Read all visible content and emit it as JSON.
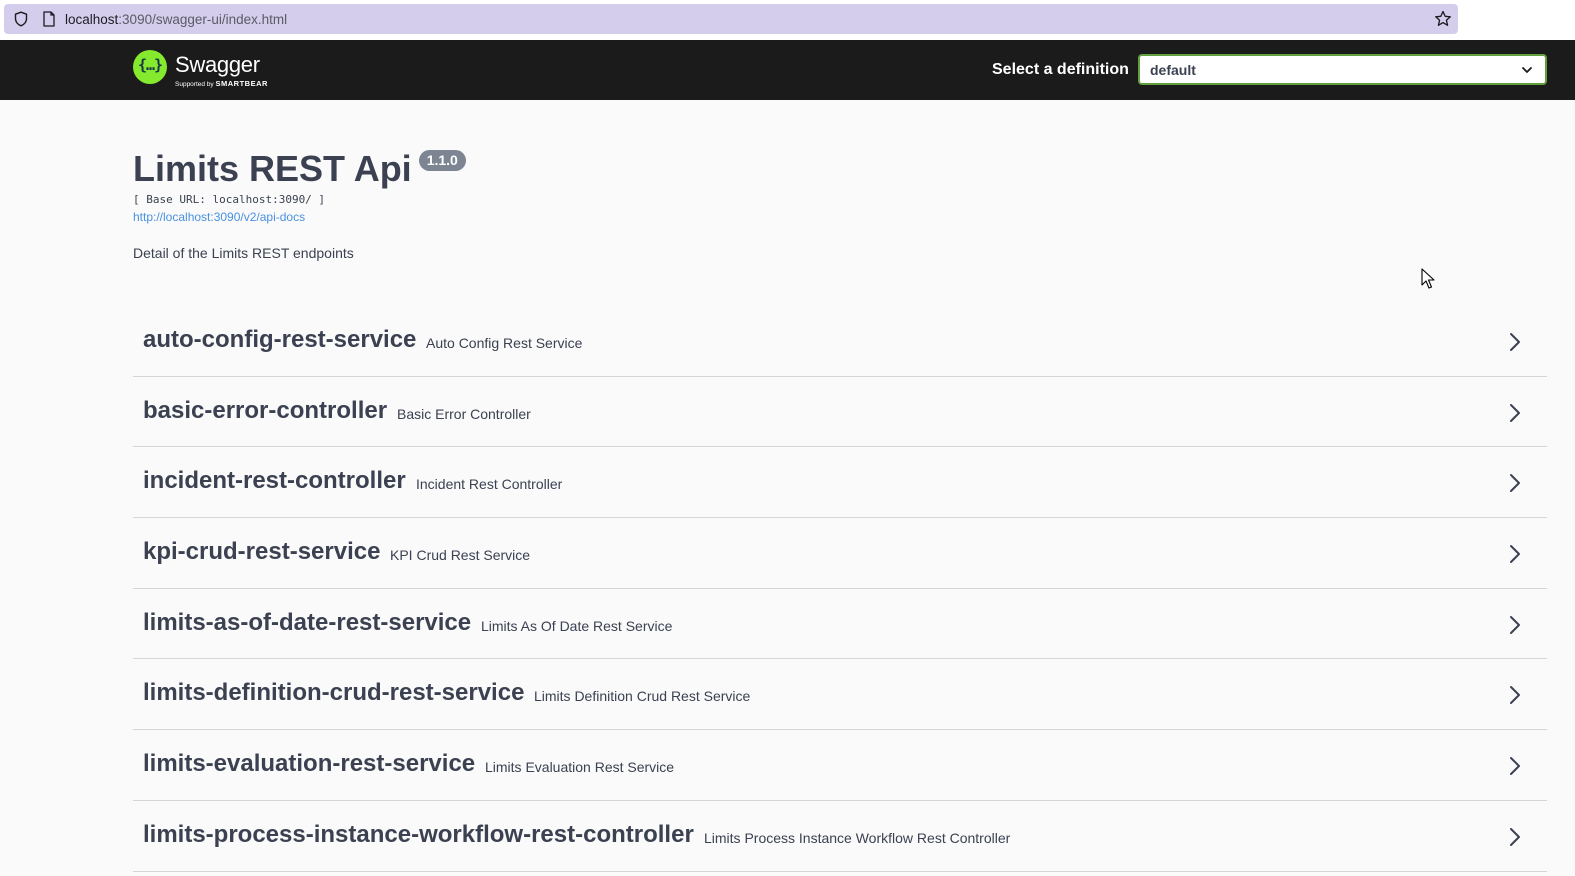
{
  "browser": {
    "url_host": "localhost",
    "url_rest": ":3090/swagger-ui/index.html"
  },
  "topbar": {
    "logo_name": "Swagger",
    "logo_supported": "Supported by",
    "logo_brand": "SMARTBEAR",
    "definition_label": "Select a definition",
    "definition_value": "default"
  },
  "info": {
    "title": "Limits REST Api",
    "version": "1.1.0",
    "base_url": "[ Base URL: localhost:3090/ ]",
    "api_docs_link": "http://localhost:3090/v2/api-docs",
    "description": "Detail of the Limits REST endpoints"
  },
  "tags": [
    {
      "name": "auto-config-rest-service",
      "description": "Auto Config Rest Service"
    },
    {
      "name": "basic-error-controller",
      "description": "Basic Error Controller"
    },
    {
      "name": "incident-rest-controller",
      "description": "Incident Rest Controller"
    },
    {
      "name": "kpi-crud-rest-service",
      "description": "KPI Crud Rest Service"
    },
    {
      "name": "limits-as-of-date-rest-service",
      "description": "Limits As Of Date Rest Service"
    },
    {
      "name": "limits-definition-crud-rest-service",
      "description": "Limits Definition Crud Rest Service"
    },
    {
      "name": "limits-evaluation-rest-service",
      "description": "Limits Evaluation Rest Service"
    },
    {
      "name": "limits-process-instance-workflow-rest-controller",
      "description": "Limits Process Instance Workflow Rest Controller"
    }
  ],
  "icons": {
    "shield": "shield-icon",
    "page": "page-icon",
    "star": "bookmark-star-icon",
    "chevron_down": "chevron-down-icon",
    "chevron_right": "chevron-right-icon"
  },
  "colors": {
    "topbar_bg": "#1b1b1b",
    "accent_green": "#85ea2d",
    "select_border": "#62a03f",
    "link": "#4990e2",
    "url_bar": "#d4cdec",
    "version_badge": "#7d8492"
  }
}
